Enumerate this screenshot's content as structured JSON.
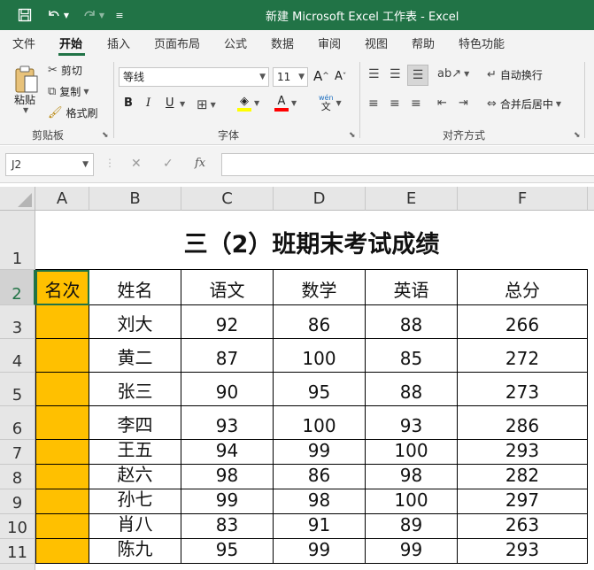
{
  "titlebar": {
    "title": "新建 Microsoft Excel 工作表  -  Excel",
    "save_icon": "save-icon",
    "undo_icon": "undo-icon",
    "redo_icon": "redo-icon",
    "customize_icon": "customize-qat-icon",
    "bg_color": "#217346"
  },
  "tabs": [
    {
      "label": "文件"
    },
    {
      "label": "开始",
      "active": true
    },
    {
      "label": "插入"
    },
    {
      "label": "页面布局"
    },
    {
      "label": "公式"
    },
    {
      "label": "数据"
    },
    {
      "label": "审阅"
    },
    {
      "label": "视图"
    },
    {
      "label": "帮助"
    },
    {
      "label": "特色功能"
    }
  ],
  "ribbon": {
    "clipboard": {
      "paste": "粘贴",
      "cut": "剪切",
      "copy": "复制",
      "format_painter": "格式刷",
      "group_label": "剪贴板"
    },
    "font": {
      "font_name": "等线",
      "font_size": "11",
      "grow": "A",
      "shrink": "A",
      "bold": "B",
      "italic": "I",
      "underline": "U",
      "font_color_glyph": "A",
      "phonetic_top": "wén",
      "phonetic_bottom": "文",
      "group_label": "字体"
    },
    "alignment": {
      "wrap_text": "自动换行",
      "merge_center": "合并后居中",
      "group_label": "对齐方式"
    }
  },
  "formula_bar": {
    "name_box": "J2",
    "cancel": "✕",
    "enter": "✓",
    "fx": "fx",
    "formula": ""
  },
  "sheet": {
    "columns": [
      "A",
      "B",
      "C",
      "D",
      "E",
      "F"
    ],
    "rows": [
      "1",
      "2",
      "3",
      "4",
      "5",
      "6",
      "7",
      "8",
      "9",
      "10",
      "11"
    ],
    "title": "三（2）班期末考试成绩",
    "headers": [
      "名次",
      "姓名",
      "语文",
      "数学",
      "英语",
      "总分"
    ],
    "data": [
      [
        "",
        "刘大",
        "92",
        "86",
        "88",
        "266"
      ],
      [
        "",
        "黄二",
        "87",
        "100",
        "85",
        "272"
      ],
      [
        "",
        "张三",
        "90",
        "95",
        "88",
        "273"
      ],
      [
        "",
        "李四",
        "93",
        "100",
        "93",
        "286"
      ],
      [
        "",
        "王五",
        "94",
        "99",
        "100",
        "293"
      ],
      [
        "",
        "赵六",
        "98",
        "86",
        "98",
        "282"
      ],
      [
        "",
        "孙七",
        "99",
        "98",
        "100",
        "297"
      ],
      [
        "",
        "肖八",
        "83",
        "91",
        "89",
        "263"
      ],
      [
        "",
        "陈九",
        "95",
        "99",
        "99",
        "293"
      ]
    ],
    "highlight_color": "#ffc000",
    "selected_row": "2"
  }
}
